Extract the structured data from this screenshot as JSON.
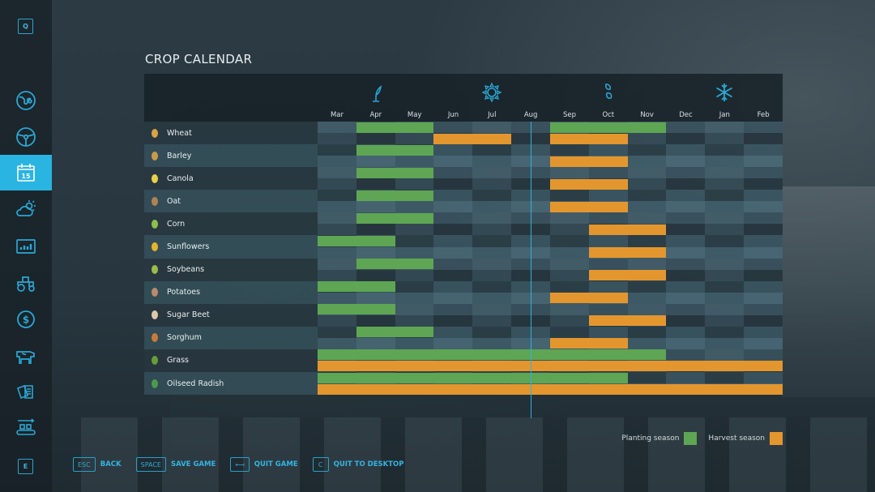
{
  "sidebar": {
    "top_key": "Q",
    "bottom_key": "E",
    "items": [
      {
        "name": "map",
        "icon": "globe-map-icon",
        "active": false
      },
      {
        "name": "vehicles",
        "icon": "steering-wheel-icon",
        "active": false
      },
      {
        "name": "calendar",
        "icon": "calendar-icon",
        "label": "15",
        "active": true
      },
      {
        "name": "weather",
        "icon": "weather-sun-cloud-icon",
        "active": false
      },
      {
        "name": "statistics",
        "icon": "bar-chart-icon",
        "active": false
      },
      {
        "name": "garage",
        "icon": "tractor-icon",
        "active": false
      },
      {
        "name": "finances",
        "icon": "dollar-icon",
        "active": false
      },
      {
        "name": "animals",
        "icon": "cow-icon",
        "active": false
      },
      {
        "name": "contracts",
        "icon": "documents-icon",
        "active": false
      },
      {
        "name": "production",
        "icon": "conveyor-icon",
        "active": false
      }
    ]
  },
  "page": {
    "title": "CROP CALENDAR"
  },
  "calendar": {
    "months": [
      "Mar",
      "Apr",
      "May",
      "Jun",
      "Jul",
      "Aug",
      "Sep",
      "Oct",
      "Nov",
      "Dec",
      "Jan",
      "Feb"
    ],
    "seasons": [
      {
        "name": "spring",
        "icon": "sprout-icon",
        "month_index": 1
      },
      {
        "name": "summer",
        "icon": "sun-icon",
        "month_index": 4
      },
      {
        "name": "autumn",
        "icon": "falling-leaves-icon",
        "month_index": 7
      },
      {
        "name": "winter",
        "icon": "snowflake-icon",
        "month_index": 10
      }
    ],
    "current_month_position": 5.5,
    "crops": [
      {
        "name": "Wheat",
        "icon": "wheat-icon",
        "planting": [
          [
            1,
            3
          ],
          [
            6,
            9
          ]
        ],
        "harvest": [
          [
            3,
            5
          ],
          [
            6,
            8
          ]
        ]
      },
      {
        "name": "Barley",
        "icon": "barley-icon",
        "planting": [
          [
            1,
            3
          ]
        ],
        "harvest": [
          [
            6,
            8
          ]
        ]
      },
      {
        "name": "Canola",
        "icon": "canola-icon",
        "planting": [
          [
            1,
            3
          ]
        ],
        "harvest": [
          [
            6,
            8
          ]
        ]
      },
      {
        "name": "Oat",
        "icon": "oat-icon",
        "planting": [
          [
            1,
            3
          ]
        ],
        "harvest": [
          [
            6,
            8
          ]
        ]
      },
      {
        "name": "Corn",
        "icon": "corn-icon",
        "planting": [
          [
            1,
            3
          ]
        ],
        "harvest": [
          [
            7,
            9
          ]
        ]
      },
      {
        "name": "Sunflowers",
        "icon": "sunflower-icon",
        "planting": [
          [
            0,
            2
          ]
        ],
        "harvest": [
          [
            7,
            9
          ]
        ]
      },
      {
        "name": "Soybeans",
        "icon": "soybean-icon",
        "planting": [
          [
            1,
            3
          ]
        ],
        "harvest": [
          [
            7,
            9
          ]
        ]
      },
      {
        "name": "Potatoes",
        "icon": "potato-icon",
        "planting": [
          [
            0,
            2
          ]
        ],
        "harvest": [
          [
            6,
            8
          ]
        ]
      },
      {
        "name": "Sugar Beet",
        "icon": "sugar-beet-icon",
        "planting": [
          [
            0,
            2
          ]
        ],
        "harvest": [
          [
            7,
            9
          ]
        ]
      },
      {
        "name": "Sorghum",
        "icon": "sorghum-icon",
        "planting": [
          [
            1,
            3
          ]
        ],
        "harvest": [
          [
            6,
            8
          ]
        ]
      },
      {
        "name": "Grass",
        "icon": "grass-icon",
        "planting": [
          [
            0,
            9
          ]
        ],
        "harvest": [
          [
            0,
            12
          ]
        ]
      },
      {
        "name": "Oilseed Radish",
        "icon": "oilseed-radish-icon",
        "planting": [
          [
            0,
            8
          ]
        ],
        "harvest": [
          [
            0,
            12
          ]
        ]
      }
    ]
  },
  "legend": {
    "planting_label": "Planting season",
    "harvest_label": "Harvest season",
    "planting_color": "#5ea653",
    "harvest_color": "#e4962e"
  },
  "footer": {
    "buttons": [
      {
        "key": "ESC",
        "label": "BACK"
      },
      {
        "key": "SPACE",
        "label": "SAVE GAME"
      },
      {
        "key": "⟻",
        "label": "QUIT GAME"
      },
      {
        "key": "C",
        "label": "QUIT TO DESKTOP"
      }
    ]
  },
  "colors": {
    "accent": "#2ab4e2"
  }
}
